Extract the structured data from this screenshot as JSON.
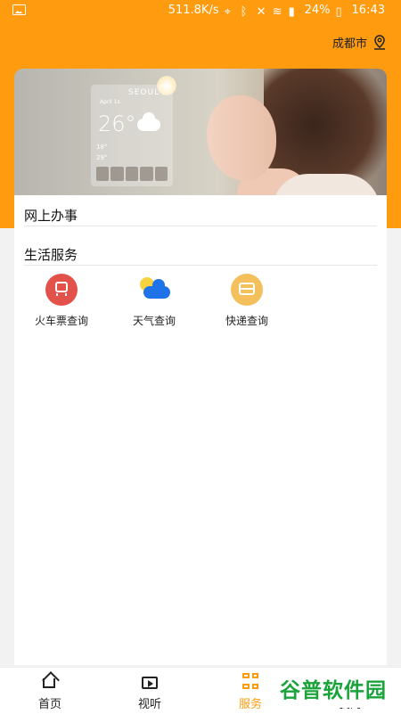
{
  "status_bar": {
    "speed": "511.8K/s",
    "battery": "24%",
    "time": "16:43"
  },
  "header": {
    "city": "成都市"
  },
  "banner": {
    "city": "SEOUL",
    "date": "April 1s",
    "temperature": "26°",
    "lines": [
      "18°",
      "29°"
    ]
  },
  "sections": {
    "online": "网上办事",
    "life": "生活服务"
  },
  "services": [
    {
      "label": "火车票查询",
      "icon": "train-icon"
    },
    {
      "label": "天气查询",
      "icon": "weather-icon"
    },
    {
      "label": "快递查询",
      "icon": "express-icon"
    }
  ],
  "tabs": [
    {
      "label": "首页",
      "icon": "home-icon"
    },
    {
      "label": "视听",
      "icon": "video-icon"
    },
    {
      "label": "服务",
      "icon": "grid-icon",
      "active": true
    },
    {
      "label": "我的",
      "icon": "user-icon"
    }
  ],
  "watermark": "谷普软件园",
  "colors": {
    "accent": "#ff9b0e",
    "background": "#f2f2f2"
  }
}
